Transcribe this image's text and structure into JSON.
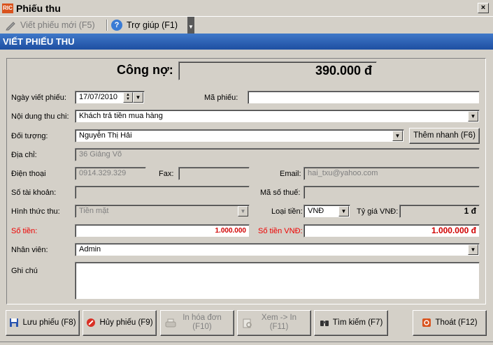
{
  "window": {
    "title": "Phiếu thu",
    "app_icon_text": "RIC",
    "close_label": "×"
  },
  "toolbar": {
    "new_receipt": "Viết phiếu mới (F5)",
    "help": "Trợ giúp (F1)",
    "overflow": "▼"
  },
  "header": {
    "title": "VIẾT PHIẾU THU"
  },
  "debt": {
    "label": "Công nợ:",
    "value": "390.000 đ"
  },
  "form": {
    "date_label": "Ngày viết phiếu:",
    "date_value": "17/07/2010",
    "code_label": "Mã phiếu:",
    "code_value": "",
    "content_label": "Nội dung thu chi:",
    "content_value": "Khách trả tiền mua hàng",
    "subject_label": "Đối tượng:",
    "subject_value": "Nguyễn Thị Hải",
    "quick_add": "Thêm nhanh (F6)",
    "address_label": "Địa chỉ:",
    "address_value": "36 Giảng Võ",
    "phone_label": "Điện thoại",
    "phone_value": "0914.329.329",
    "fax_label": "Fax:",
    "fax_value": "",
    "email_label": "Email:",
    "email_value": "hai_txu@yahoo.com",
    "account_label": "Số tài khoản:",
    "account_value": "",
    "tax_label": "Mã số thuế:",
    "tax_value": "",
    "method_label": "Hình thức thu:",
    "method_value": "Tiền mặt",
    "currency_label": "Loại tiền:",
    "currency_value": "VNĐ",
    "rate_label": "Tỷ giá VNĐ:",
    "rate_value": "1 đ",
    "amount_label": "Số tiền:",
    "amount_value": "1.000.000",
    "amount_vnd_label": "Số tiền VNĐ:",
    "amount_vnd_value": "1.000.000 đ",
    "staff_label": "Nhân viên:",
    "staff_value": "Admin",
    "note_label": "Ghi chú",
    "note_value": ""
  },
  "buttons": {
    "save": "Lưu phiếu (F8)",
    "cancel": "Hủy phiếu (F9)",
    "print_invoice_1": "In hóa đơn",
    "print_invoice_2": "(F10)",
    "preview_1": "Xem -> In",
    "preview_2": "(F11)",
    "search": "Tìm kiếm (F7)",
    "exit": "Thoát (F12)"
  },
  "colors": {
    "header": "#1e4fa1",
    "required_label": "#e00000",
    "amount_text": "#d00000"
  },
  "icons": [
    "pencil-icon",
    "help-icon",
    "save-icon",
    "cancel-icon",
    "print-icon",
    "preview-icon",
    "binoculars-icon",
    "exit-icon"
  ]
}
